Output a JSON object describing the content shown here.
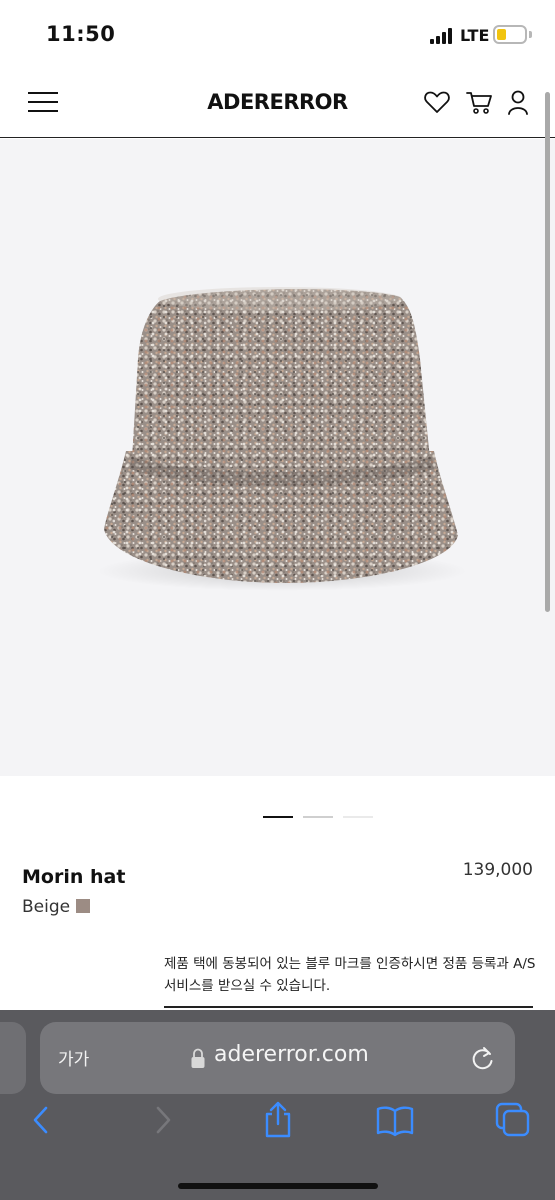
{
  "status_bar": {
    "time": "11:50",
    "network": "LTE",
    "battery_color": "#f1c40f"
  },
  "header": {
    "logo": "ADERERROR",
    "icons": [
      "menu-icon",
      "heart-icon",
      "cart-icon",
      "user-icon"
    ]
  },
  "gallery": {
    "image": "bucket-hat-photo",
    "pages": 3,
    "active_page": 1
  },
  "product": {
    "name": "Morin hat",
    "price": "139,000",
    "color_name": "Beige",
    "swatch_color": "#9c8c84",
    "auth_note": "제품 택에 동봉되어 있는 블루 마크를 인증하시면 정품 등록과 A/S 서비스를 받으실 수 있습니다."
  },
  "browser": {
    "aa_label": "가가",
    "url": "adererror.com",
    "toolbar": [
      "back-icon",
      "forward-icon",
      "share-icon",
      "bookmarks-icon",
      "tabs-icon"
    ]
  }
}
